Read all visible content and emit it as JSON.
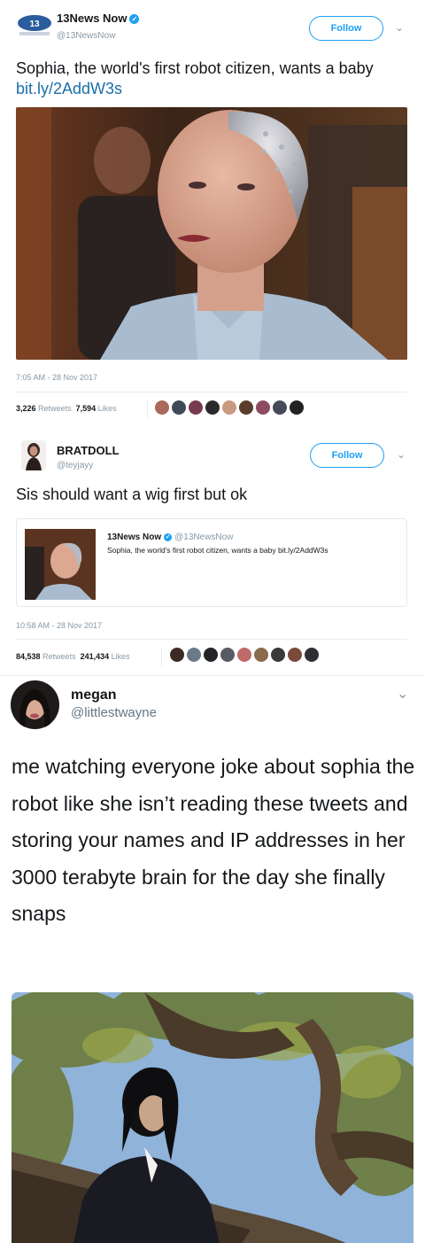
{
  "tweet1": {
    "display_name": "13News Now",
    "handle": "@13NewsNow",
    "follow_label": "Follow",
    "text": "Sophia, the world's first robot citizen, wants a baby ",
    "link": "bit.ly/2AddW3s",
    "timestamp": "7:05 AM - 28 Nov 2017",
    "retweets_count": "3,226",
    "retweets_label": "Retweets",
    "likes_count": "7,594",
    "likes_label": "Likes",
    "avatar_icon": "13news-logo-icon",
    "image_icon": "sophia-robot-photo"
  },
  "tweet2": {
    "display_name": "BRATDOLL",
    "handle": "@teyjayy",
    "follow_label": "Follow",
    "text": "Sis should want a wig first but ok",
    "quote": {
      "display_name": "13News Now",
      "handle": "@13NewsNow",
      "text": "Sophia, the world's first robot citizen, wants a baby bit.ly/2AddW3s"
    },
    "timestamp": "10:58 AM - 28 Nov 2017",
    "retweets_count": "84,538",
    "retweets_label": "Retweets",
    "likes_count": "241,434",
    "likes_label": "Likes"
  },
  "tweet3": {
    "display_name": "megan",
    "handle": "@littlestwayne",
    "text": "me watching everyone joke about sophia the robot like she isn’t reading these tweets and storing your names and IP addresses in her 3000 terabyte brain for the day she finally snaps",
    "image_icon": "man-in-tree-photo"
  },
  "colors": {
    "accent": "#1da1f2",
    "link": "#1b6fa8",
    "muted": "#8899a6",
    "divider": "#e6ecf0"
  }
}
